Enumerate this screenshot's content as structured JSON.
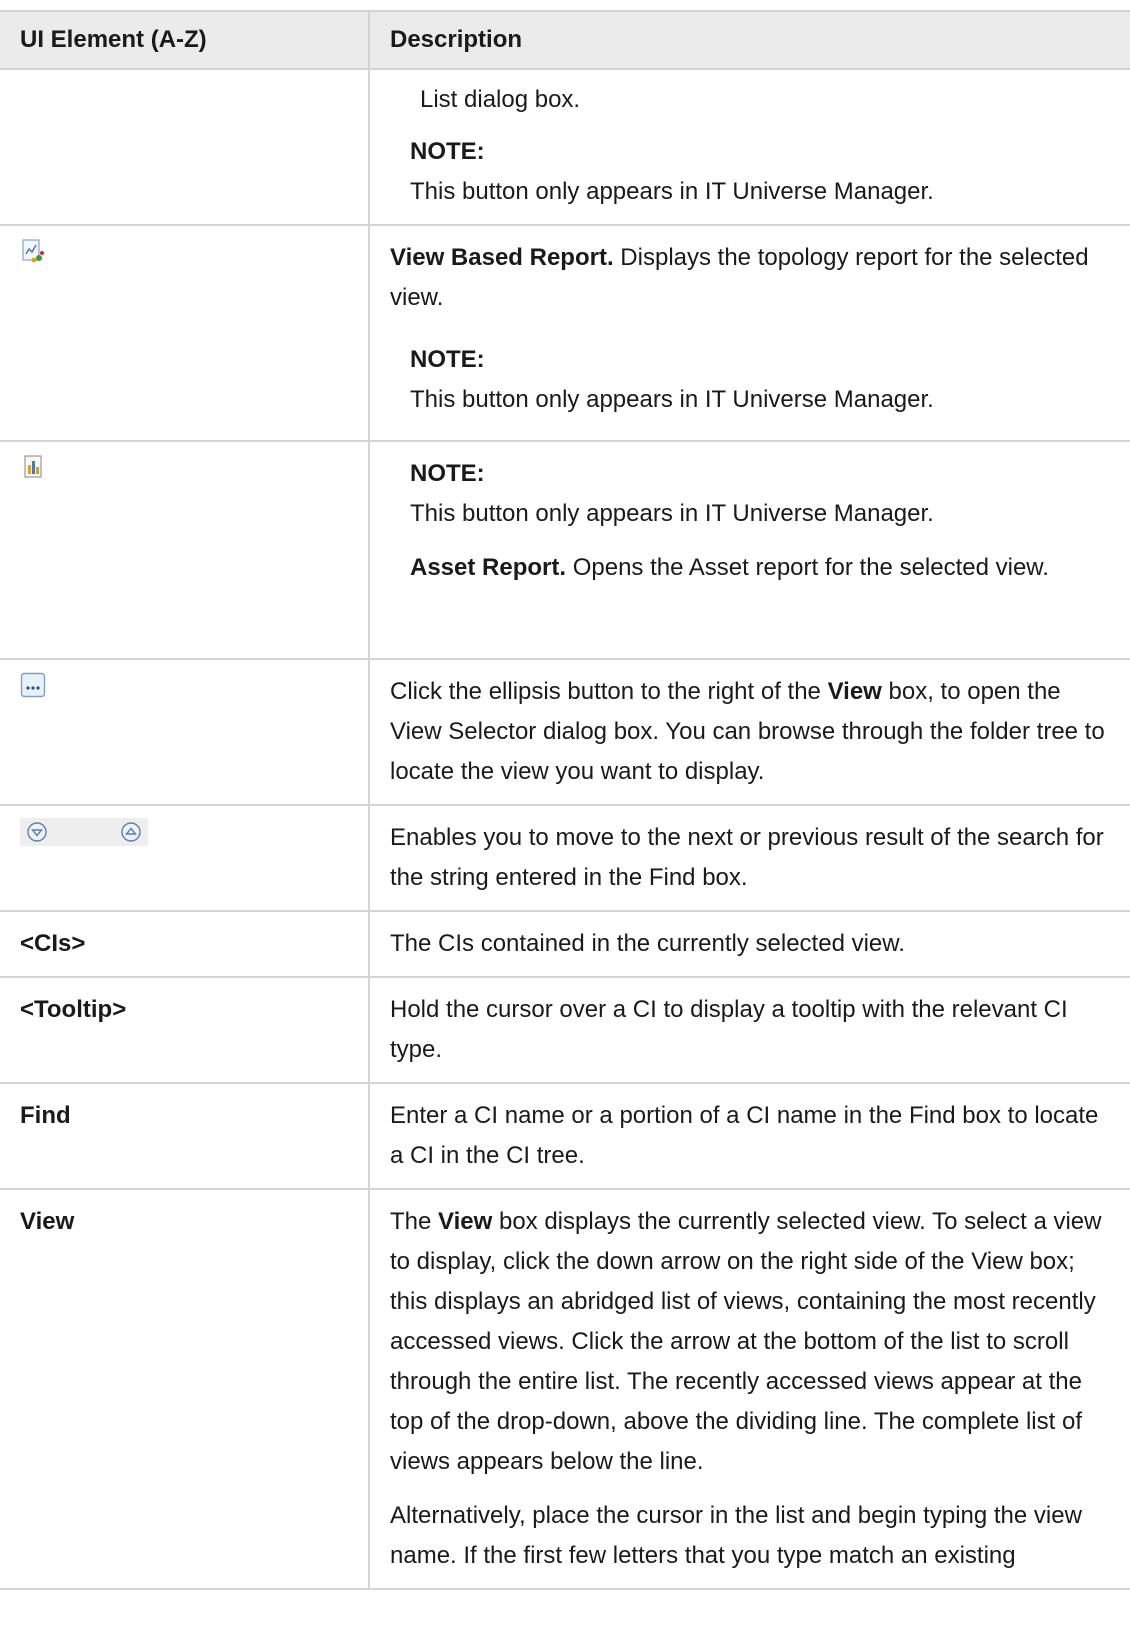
{
  "table": {
    "header": {
      "col_element": "UI Element (A-Z)",
      "col_description": "Description"
    },
    "rows": {
      "continued": {
        "text": "List dialog box.",
        "note_title": "NOTE:",
        "note_text": "This button only appears in IT Universe Manager."
      },
      "view_report": {
        "icon": "view-based-report-icon",
        "title": "View Based Report.",
        "text": " Displays the topology report for the selected view.",
        "note_title": "NOTE:",
        "note_text": "This button only appears in IT Universe Manager."
      },
      "asset_report": {
        "icon": "asset-report-icon",
        "note_title": "NOTE:",
        "note_text": "This button only appears in IT Universe Manager.",
        "title": "Asset Report.",
        "text": " Opens the Asset report for the selected view."
      },
      "ellipsis": {
        "icon": "ellipsis-button-icon",
        "text_before": "Click the ellipsis button to the right of the ",
        "bold": "View",
        "text_after": " box, to open the View Selector dialog box. You can browse through the folder tree to locate the view you want to display."
      },
      "nav": {
        "icons": [
          "next-result-icon",
          "previous-result-icon"
        ],
        "text": "Enables you to move to the next or previous result of the search for the string entered in the Find box."
      },
      "cis": {
        "element": "<CIs>",
        "text": "The CIs contained in the currently selected view."
      },
      "tooltip": {
        "element": "<Tooltip>",
        "text": "Hold the cursor over a CI to display a tooltip with the relevant CI type."
      },
      "find": {
        "element": "Find",
        "text": "Enter a CI name or a portion of a CI name in the Find box to locate a CI in the CI tree."
      },
      "view": {
        "element": "View",
        "p1_before": "The ",
        "p1_bold": "View",
        "p1_after": " box displays the currently selected view. To select a view to display, click the down arrow on the right side of the View box; this displays an abridged list of views, containing the most recently accessed views. Click the arrow at the bottom of the list to scroll through the entire list. The recently accessed views appear at the top of the drop-down, above the dividing line. The complete list of views appears below the line.",
        "p2": "Alternatively, place the cursor in the list and begin typing the view name. If the first few letters that you type match an existing"
      }
    }
  }
}
